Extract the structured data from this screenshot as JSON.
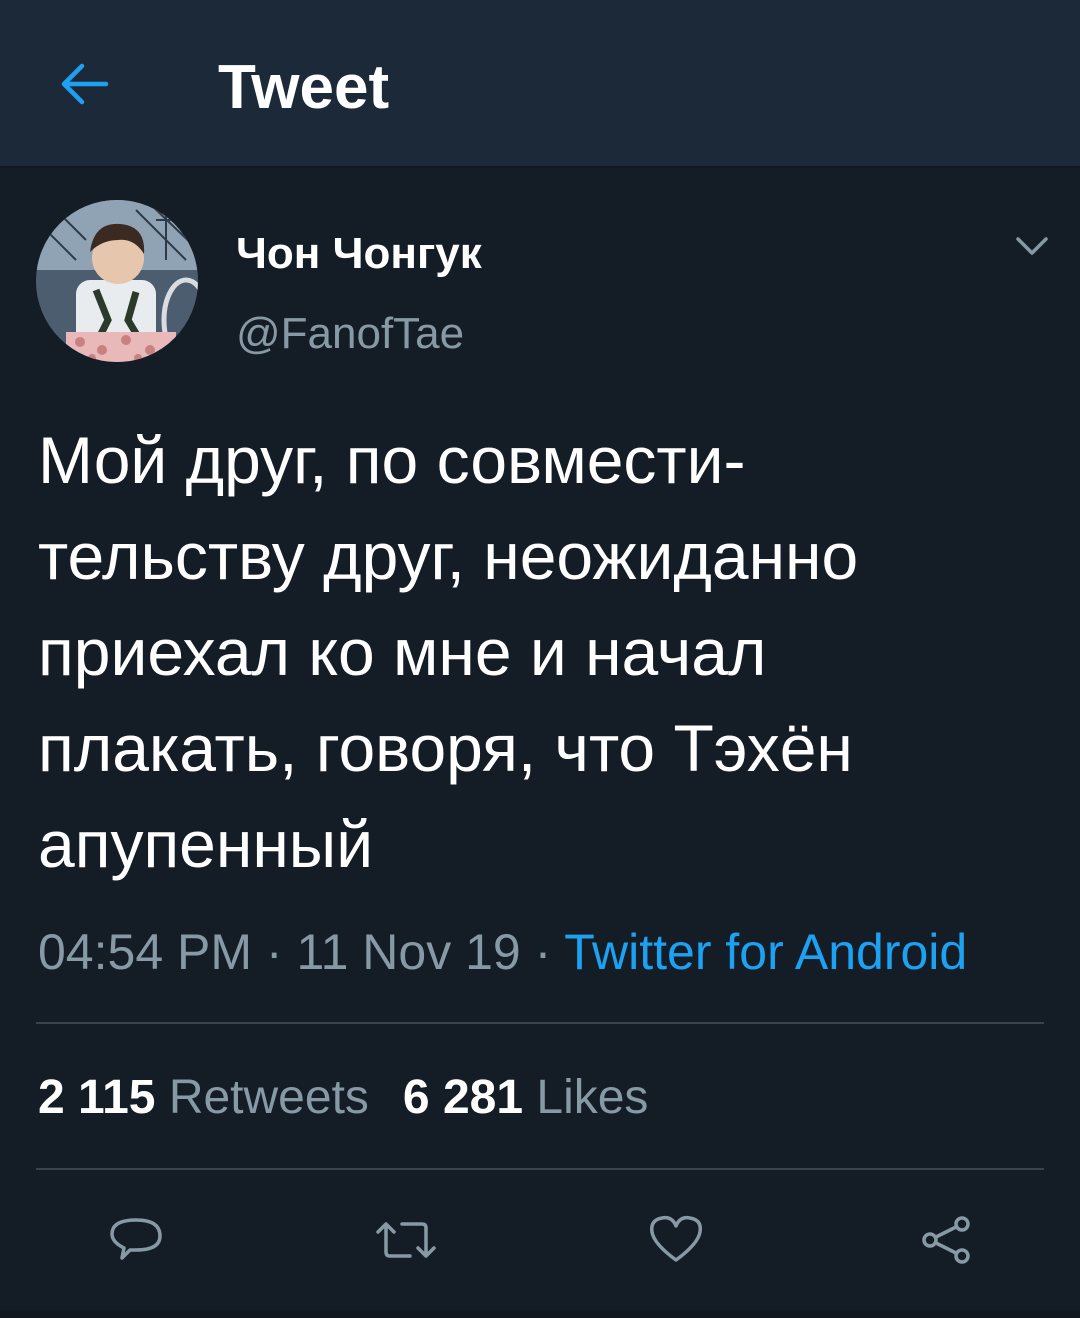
{
  "header": {
    "title": "Tweet",
    "back_icon": "arrow-left-icon"
  },
  "author": {
    "display_name": "Чон Чонгук",
    "handle": "@FanofTae",
    "menu_icon": "chevron-down-icon"
  },
  "tweet": {
    "text": "Мой друг, по совмести-\nтельству друг, неожиданно\nприехал ко мне и начал\nплакать, говоря, что Тэхён\nапупенный",
    "time": "04:54 PM",
    "separator": "·",
    "date": "11 Nov 19",
    "source": "Twitter for Android"
  },
  "stats": {
    "retweets_count": "2 115",
    "retweets_label": "Retweets",
    "likes_count": "6 281",
    "likes_label": "Likes"
  },
  "actions": [
    {
      "name": "reply",
      "icon": "reply-bubble-icon"
    },
    {
      "name": "retweet",
      "icon": "retweet-icon"
    },
    {
      "name": "like",
      "icon": "heart-icon"
    },
    {
      "name": "share",
      "icon": "share-icon"
    }
  ],
  "colors": {
    "background": "#141d26",
    "header": "#1c2938",
    "accent": "#1da1f2",
    "muted": "#8899a6",
    "divider": "#38444d"
  }
}
